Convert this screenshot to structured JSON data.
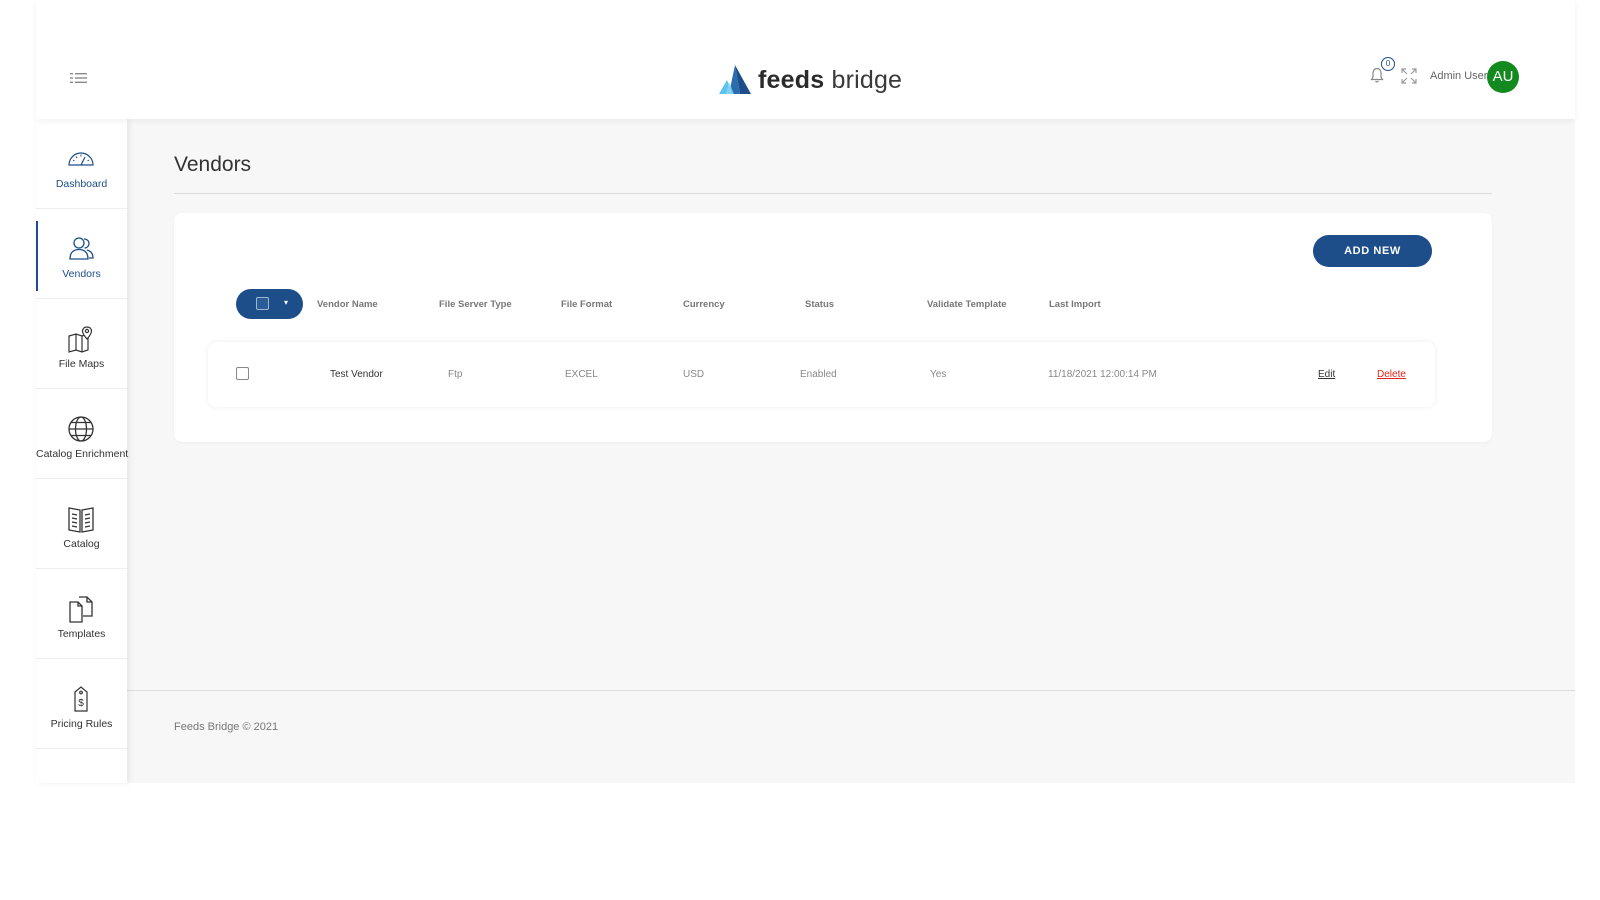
{
  "header": {
    "logo_bold": "feeds",
    "logo_light": "bridge",
    "notification_count": "0",
    "user_name": "Admin User",
    "avatar_initials": "AU"
  },
  "sidebar": {
    "items": [
      {
        "label": "Dashboard",
        "icon": "speedometer-icon"
      },
      {
        "label": "Vendors",
        "icon": "users-icon"
      },
      {
        "label": "File Maps",
        "icon": "map-icon"
      },
      {
        "label": "Catalog Enrichment",
        "icon": "globe-icon"
      },
      {
        "label": "Catalog",
        "icon": "book-icon"
      },
      {
        "label": "Templates",
        "icon": "documents-icon"
      },
      {
        "label": "Pricing Rules",
        "icon": "price-tag-icon"
      }
    ],
    "active": "Vendors"
  },
  "main": {
    "title": "Vendors",
    "add_button": "ADD NEW",
    "columns": [
      "Vendor Name",
      "File Server Type",
      "File Format",
      "Currency",
      "Status",
      "Validate Template",
      "Last Import"
    ],
    "rows": [
      {
        "vendor_name": "Test Vendor",
        "file_server_type": "Ftp",
        "file_format": "EXCEL",
        "currency": "USD",
        "status": "Enabled",
        "validate_template": "Yes",
        "last_import": "11/18/2021 12:00:14 PM",
        "edit": "Edit",
        "delete": "Delete"
      }
    ]
  },
  "footer": {
    "text": "Feeds Bridge © 2021"
  },
  "colors": {
    "primary": "#1d4e89",
    "avatar": "#128a1f",
    "delete": "#e0261b",
    "background": "#f7f7f7"
  }
}
